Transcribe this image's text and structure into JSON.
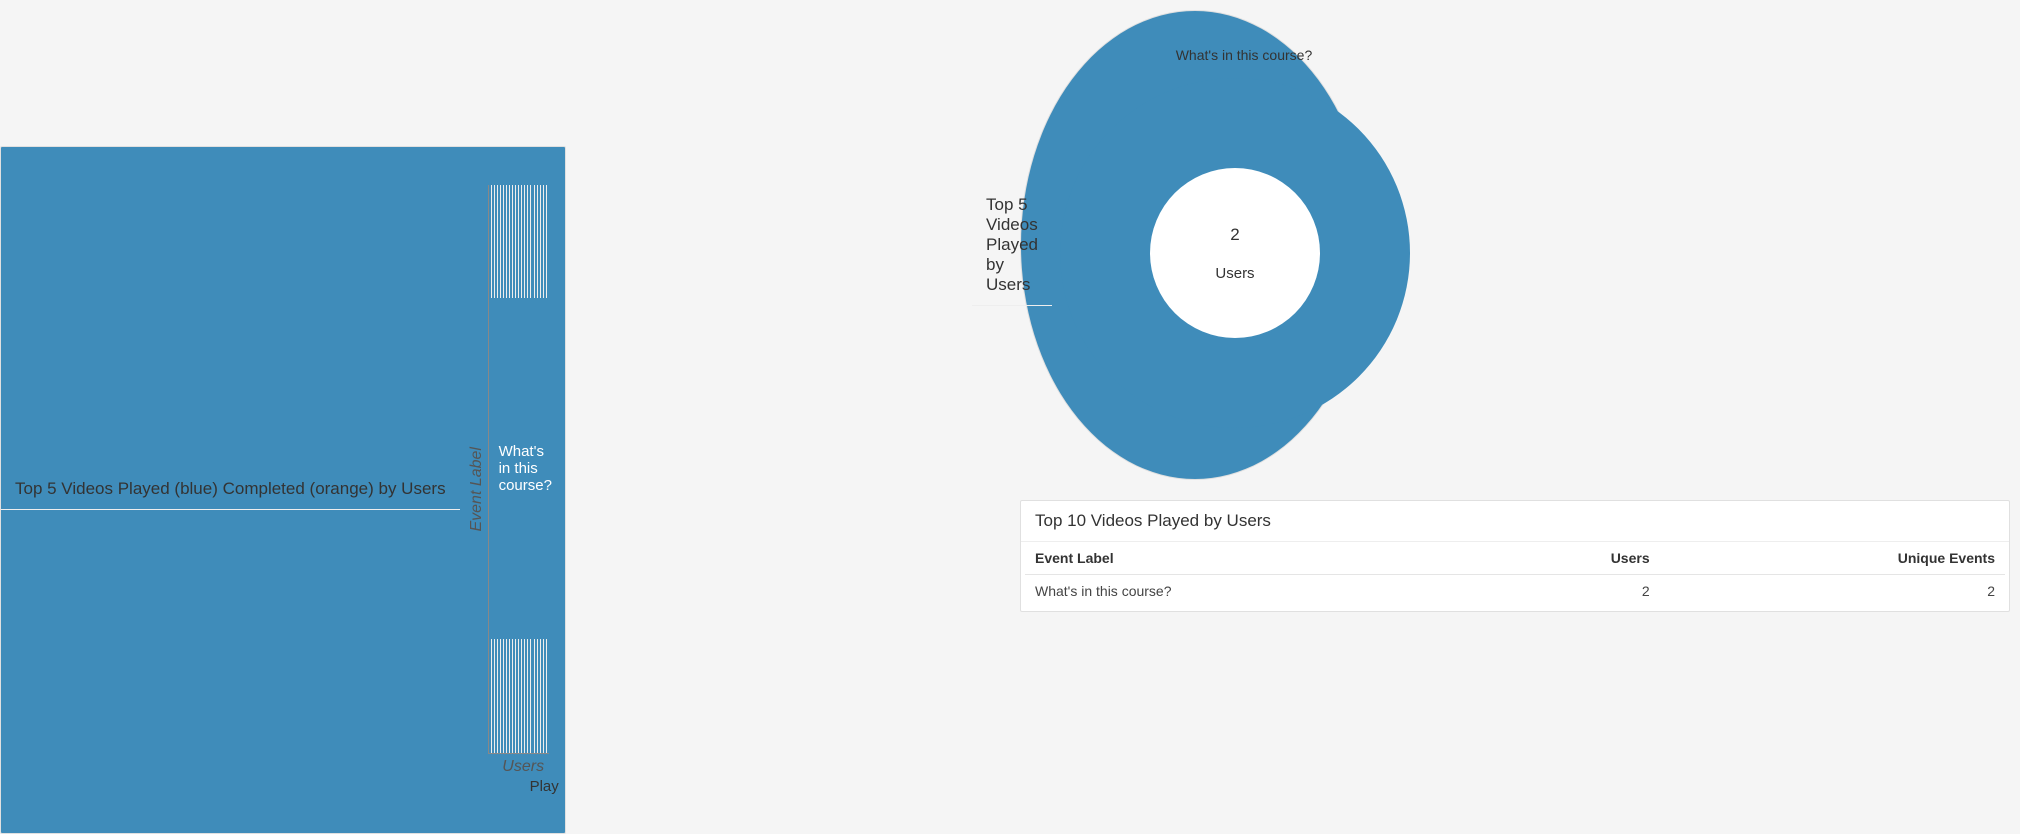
{
  "chart_data": [
    {
      "type": "bar",
      "orientation": "horizontal",
      "title": "Top 5 Videos Played (blue) Completed (orange) by Users",
      "xlabel": "Users",
      "ylabel": "Event Label",
      "categories": [
        "What's in this course?"
      ],
      "series": [
        {
          "name": "Play",
          "color": "#3f8cba",
          "values": [
            2
          ]
        }
      ],
      "xlim": [
        0,
        2
      ],
      "grid_divisions": 20
    },
    {
      "type": "pie",
      "subtype": "donut",
      "title": "Top 5 Videos Played by Users",
      "center_value": 2,
      "center_label": "Users",
      "slices": [
        {
          "label": "What's in this course?",
          "value": 2,
          "color": "#3f8cba"
        }
      ]
    },
    {
      "type": "table",
      "title": "Top 10 Videos Played by Users",
      "columns": [
        "Event Label",
        "Users",
        "Unique Events"
      ],
      "rows": [
        [
          "What's in this course?",
          2,
          2
        ]
      ]
    }
  ],
  "bar": {
    "title": "Top 5 Videos Played (blue) Completed (orange) by Users",
    "y_axis_title": "Event Label",
    "x_axis_title": "Users",
    "legend_label": "Play",
    "bar_label": "What's in this course?",
    "legend_color": "#3f8cba",
    "bar_width_pct": 100
  },
  "donut": {
    "title": "Top 5 Videos Played by Users",
    "legend_label": "What's in this course?",
    "center_value": "2",
    "center_label": "Users",
    "color": "#3f8cba"
  },
  "table": {
    "title": "Top 10 Videos Played by Users",
    "col1": "Event Label",
    "col2": "Users",
    "col3": "Unique Events",
    "row1_c1": "What's in this course?",
    "row1_c2": "2",
    "row1_c3": "2"
  }
}
